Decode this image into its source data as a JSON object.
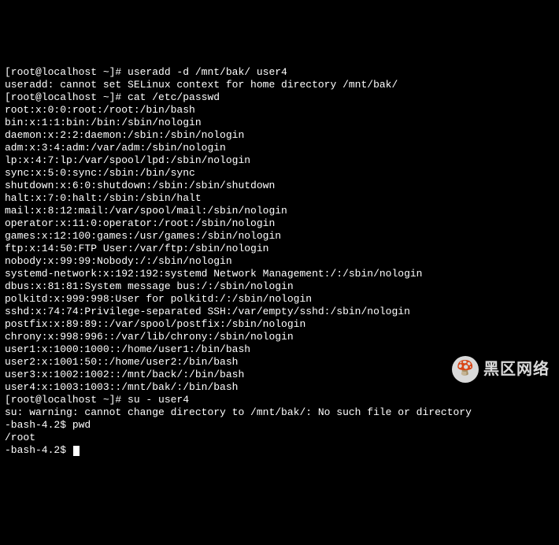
{
  "lines": [
    "                                                           ",
    "[root@localhost ~]# useradd -d /mnt/bak/ user4",
    "useradd: cannot set SELinux context for home directory /mnt/bak/",
    "[root@localhost ~]# cat /etc/passwd",
    "root:x:0:0:root:/root:/bin/bash",
    "bin:x:1:1:bin:/bin:/sbin/nologin",
    "daemon:x:2:2:daemon:/sbin:/sbin/nologin",
    "adm:x:3:4:adm:/var/adm:/sbin/nologin",
    "lp:x:4:7:lp:/var/spool/lpd:/sbin/nologin",
    "sync:x:5:0:sync:/sbin:/bin/sync",
    "shutdown:x:6:0:shutdown:/sbin:/sbin/shutdown",
    "halt:x:7:0:halt:/sbin:/sbin/halt",
    "mail:x:8:12:mail:/var/spool/mail:/sbin/nologin",
    "operator:x:11:0:operator:/root:/sbin/nologin",
    "games:x:12:100:games:/usr/games:/sbin/nologin",
    "ftp:x:14:50:FTP User:/var/ftp:/sbin/nologin",
    "nobody:x:99:99:Nobody:/:/sbin/nologin",
    "systemd-network:x:192:192:systemd Network Management:/:/sbin/nologin",
    "dbus:x:81:81:System message bus:/:/sbin/nologin",
    "polkitd:x:999:998:User for polkitd:/:/sbin/nologin",
    "sshd:x:74:74:Privilege-separated SSH:/var/empty/sshd:/sbin/nologin",
    "postfix:x:89:89::/var/spool/postfix:/sbin/nologin",
    "chrony:x:998:996::/var/lib/chrony:/sbin/nologin",
    "user1:x:1000:1000::/home/user1:/bin/bash",
    "user2:x:1001:50::/home/user2:/bin/bash",
    "user3:x:1002:1002::/mnt/back/:/bin/bash",
    "user4:x:1003:1003::/mnt/bak/:/bin/bash",
    "[root@localhost ~]# su - user4",
    "su: warning: cannot change directory to /mnt/bak/: No such file or directory",
    "-bash-4.2$ pwd",
    "/root",
    "-bash-4.2$ "
  ],
  "watermark": {
    "icon": "🍄",
    "text": "黑区网络"
  }
}
